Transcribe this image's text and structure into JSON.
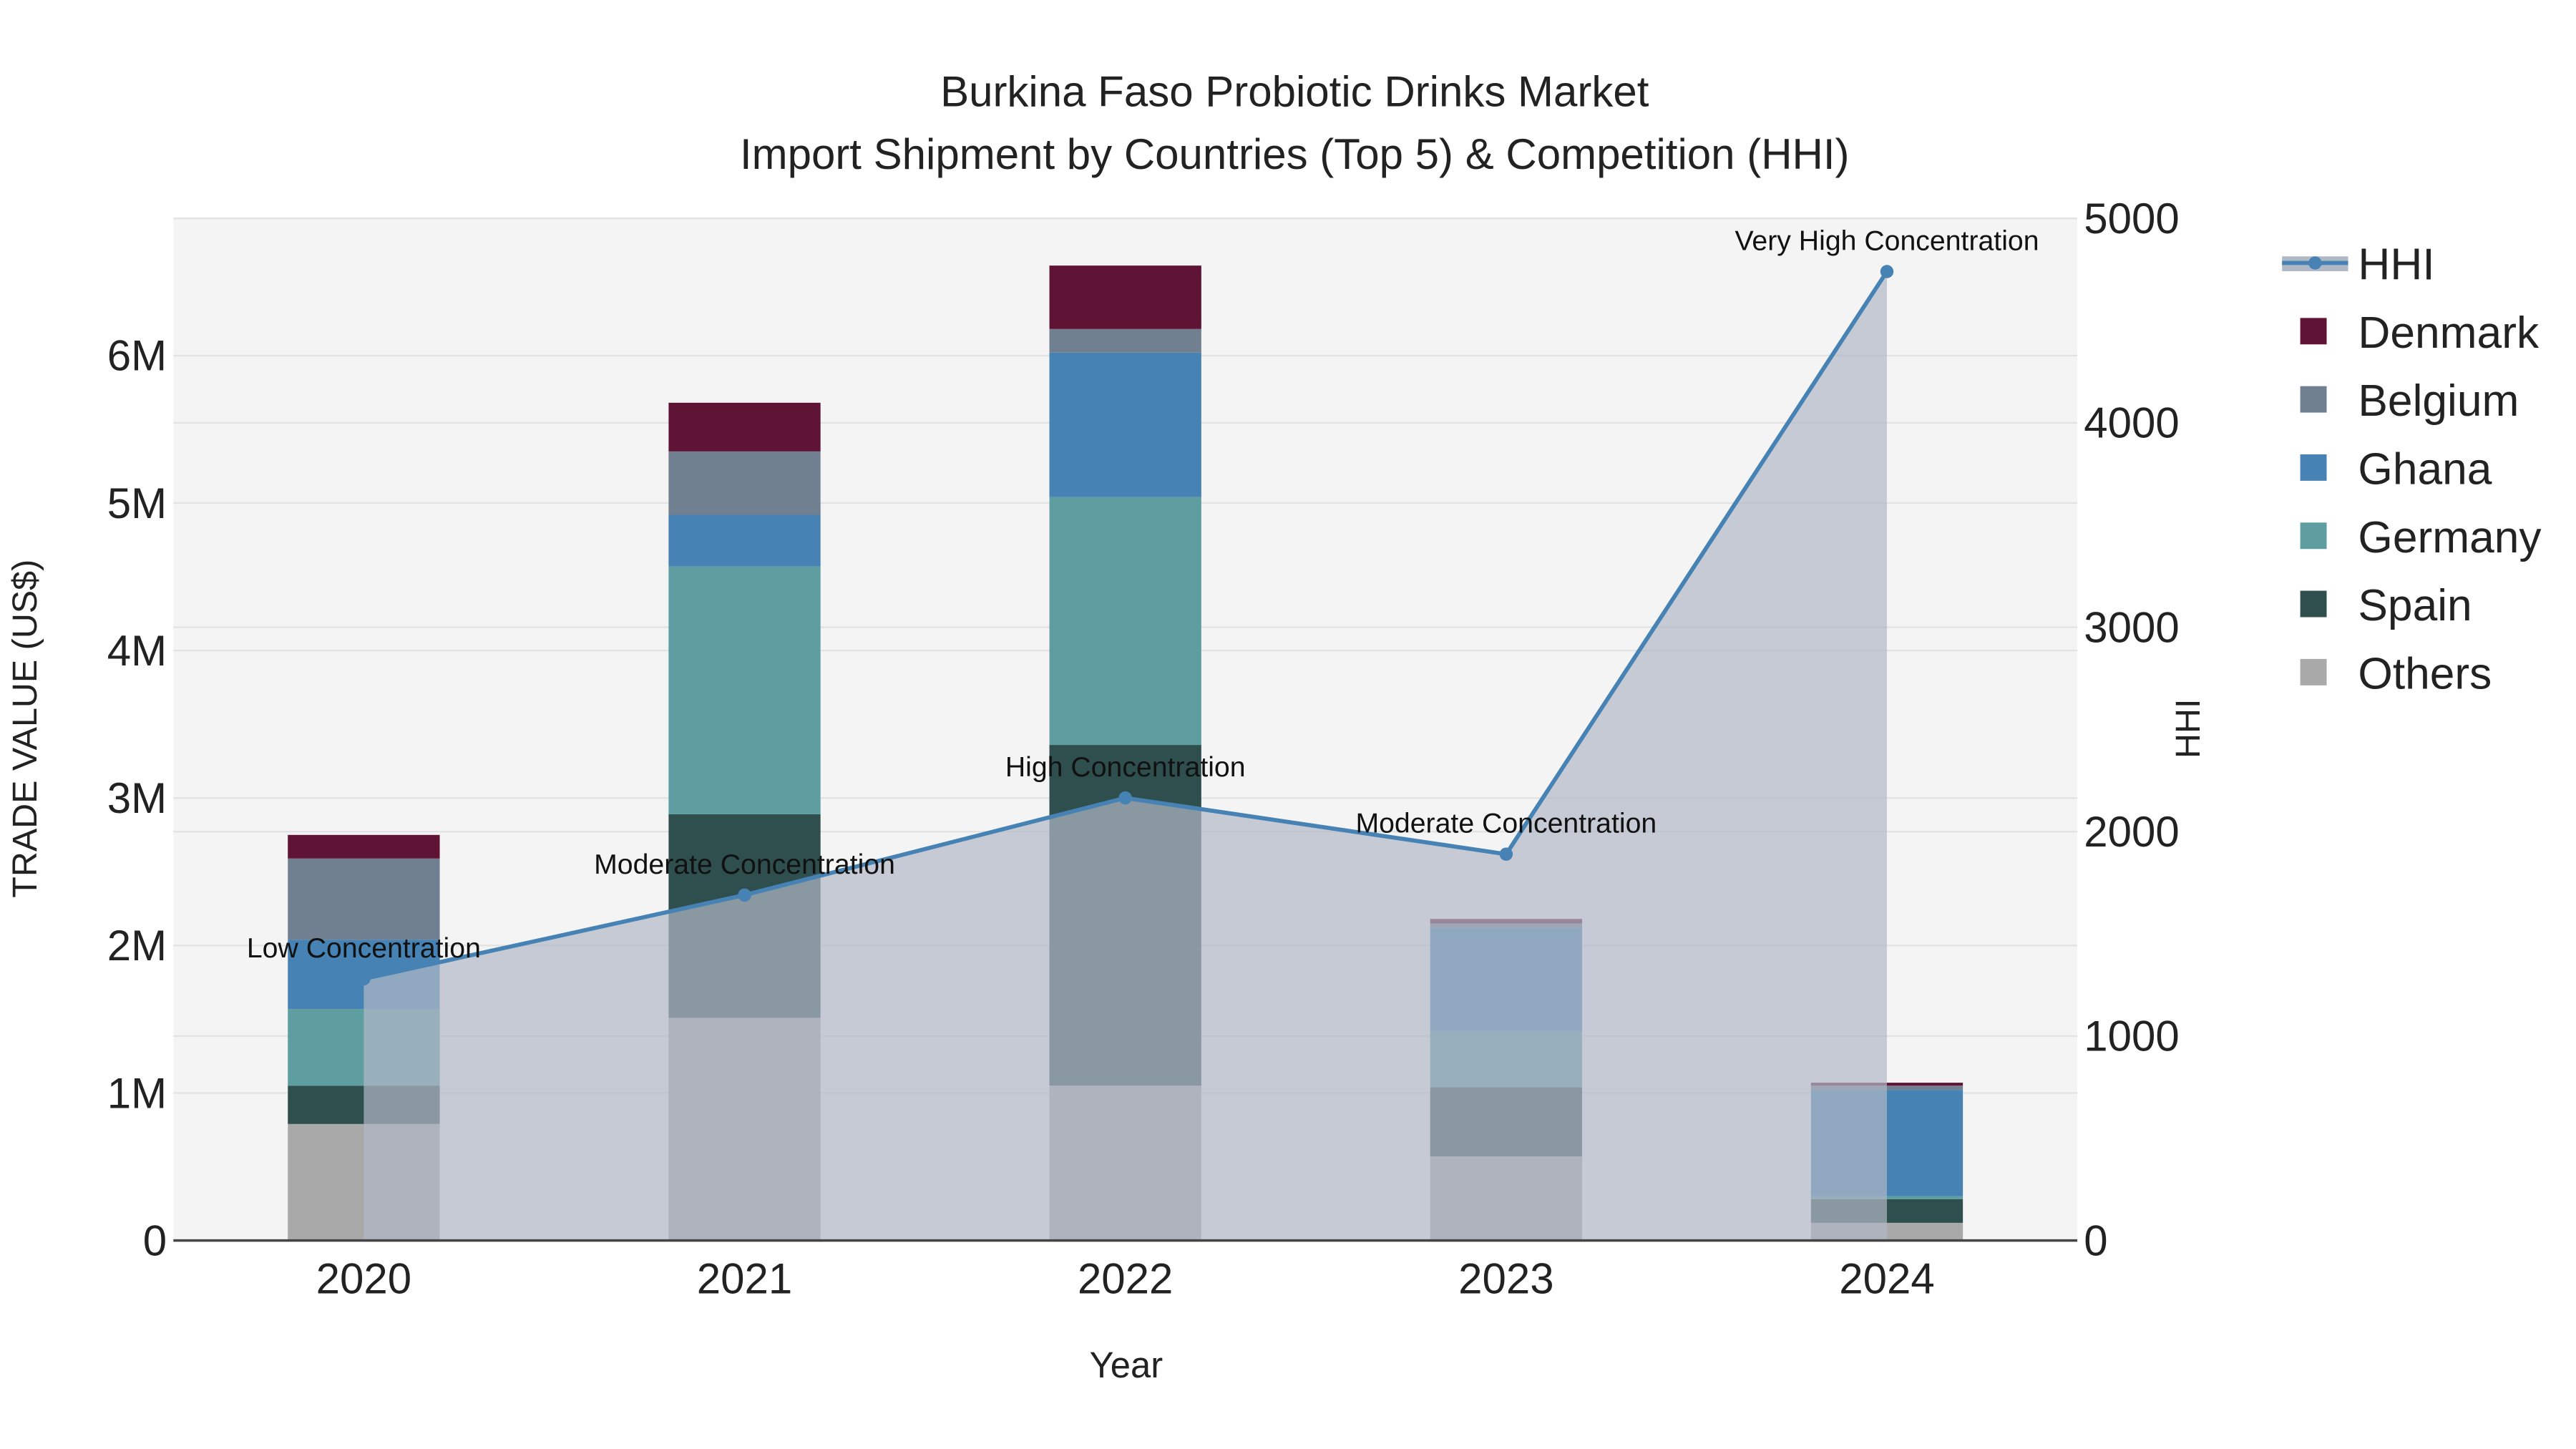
{
  "chart_data": {
    "type": "bar",
    "title": "Burkina Faso Probiotic Drinks Market",
    "subtitle": "Import Shipment by Countries (Top 5) & Competition (HHI)",
    "xlabel": "Year",
    "ylabel": "TRADE VALUE (US$)",
    "y2label": "HHI",
    "categories": [
      "2020",
      "2021",
      "2022",
      "2023",
      "2024"
    ],
    "stacked": true,
    "ylim": [
      0,
      6930000
    ],
    "y2lim": [
      0,
      5000
    ],
    "yticks": [
      {
        "v": 0,
        "label": "0"
      },
      {
        "v": 1000000,
        "label": "1M"
      },
      {
        "v": 2000000,
        "label": "2M"
      },
      {
        "v": 3000000,
        "label": "3M"
      },
      {
        "v": 4000000,
        "label": "4M"
      },
      {
        "v": 5000000,
        "label": "5M"
      },
      {
        "v": 6000000,
        "label": "6M"
      }
    ],
    "y2ticks": [
      {
        "v": 0,
        "label": "0"
      },
      {
        "v": 1000,
        "label": "1000"
      },
      {
        "v": 2000,
        "label": "2000"
      },
      {
        "v": 3000,
        "label": "3000"
      },
      {
        "v": 4000,
        "label": "4000"
      },
      {
        "v": 5000,
        "label": "5000"
      }
    ],
    "grid": true,
    "legend_placement": "right",
    "series": [
      {
        "name": "Others",
        "color": "#a9a9a9",
        "values": [
          790000,
          1510000,
          1050000,
          570000,
          120000
        ]
      },
      {
        "name": "Spain",
        "color": "#2f4f4f",
        "values": [
          260000,
          1380000,
          2310000,
          470000,
          160000
        ]
      },
      {
        "name": "Germany",
        "color": "#5f9ea0",
        "values": [
          520000,
          1680000,
          1680000,
          380000,
          20000
        ]
      },
      {
        "name": "Ghana",
        "color": "#4682b4",
        "values": [
          470000,
          350000,
          980000,
          700000,
          720000
        ]
      },
      {
        "name": "Belgium",
        "color": "#708090",
        "values": [
          550000,
          430000,
          160000,
          30000,
          30000
        ]
      },
      {
        "name": "Denmark",
        "color": "#5f1436",
        "values": [
          160000,
          330000,
          430000,
          30000,
          20000
        ]
      }
    ],
    "line_series": {
      "name": "HHI",
      "axis": "right",
      "color": "#4682b4",
      "area_fill": "#b0b8c6",
      "values": [
        1280,
        1690,
        2165,
        1890,
        4740
      ],
      "annotations": [
        "Low Concentration",
        "Moderate Concentration",
        "High Concentration",
        "Moderate Concentration",
        "Very High Concentration"
      ]
    },
    "legend_order": [
      "HHI",
      "Denmark",
      "Belgium",
      "Ghana",
      "Germany",
      "Spain",
      "Others"
    ]
  }
}
